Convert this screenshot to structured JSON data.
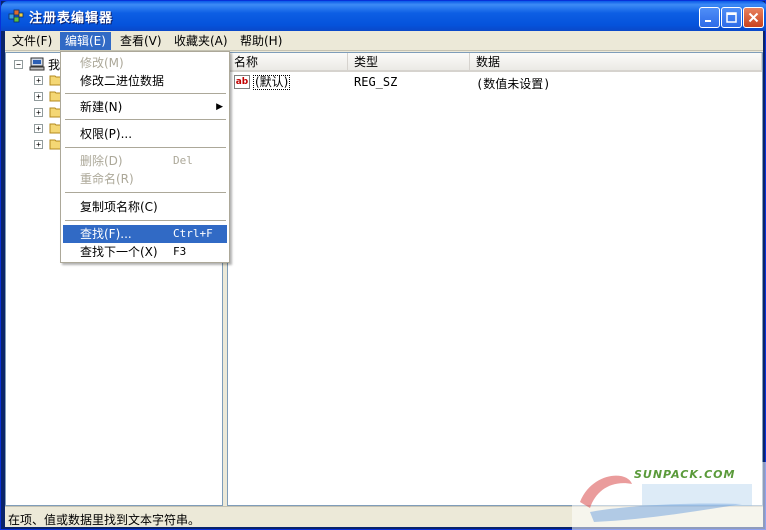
{
  "window": {
    "title": "注册表编辑器"
  },
  "menubar": {
    "items": [
      {
        "label": "文件(F)"
      },
      {
        "label": "编辑(E)"
      },
      {
        "label": "查看(V)"
      },
      {
        "label": "收藏夹(A)"
      },
      {
        "label": "帮助(H)"
      }
    ]
  },
  "tree": {
    "root_label": "我"
  },
  "list": {
    "headers": [
      "名称",
      "类型",
      "数据"
    ],
    "rows": [
      {
        "name": "(默认)",
        "type": "REG_SZ",
        "data": "(数值未设置)"
      }
    ]
  },
  "edit_menu": {
    "items": [
      {
        "label": "修改(M)"
      },
      {
        "label": "修改二进位数据"
      },
      {
        "label": "新建(N)"
      },
      {
        "label": "权限(P)..."
      },
      {
        "label": "删除(D)",
        "shortcut": "Del"
      },
      {
        "label": "重命名(R)"
      },
      {
        "label": "复制项名称(C)"
      },
      {
        "label": "查找(F)...",
        "shortcut": "Ctrl+F"
      },
      {
        "label": "查找下一个(X)",
        "shortcut": "F3"
      }
    ]
  },
  "statusbar": {
    "text": "在项、值或数据里找到文本字符串。"
  },
  "watermark": {
    "text": "SUNPACK.COM"
  },
  "colors": {
    "title_blue": "#0553db",
    "highlight": "#316ac5",
    "disabled": "#aca899"
  }
}
